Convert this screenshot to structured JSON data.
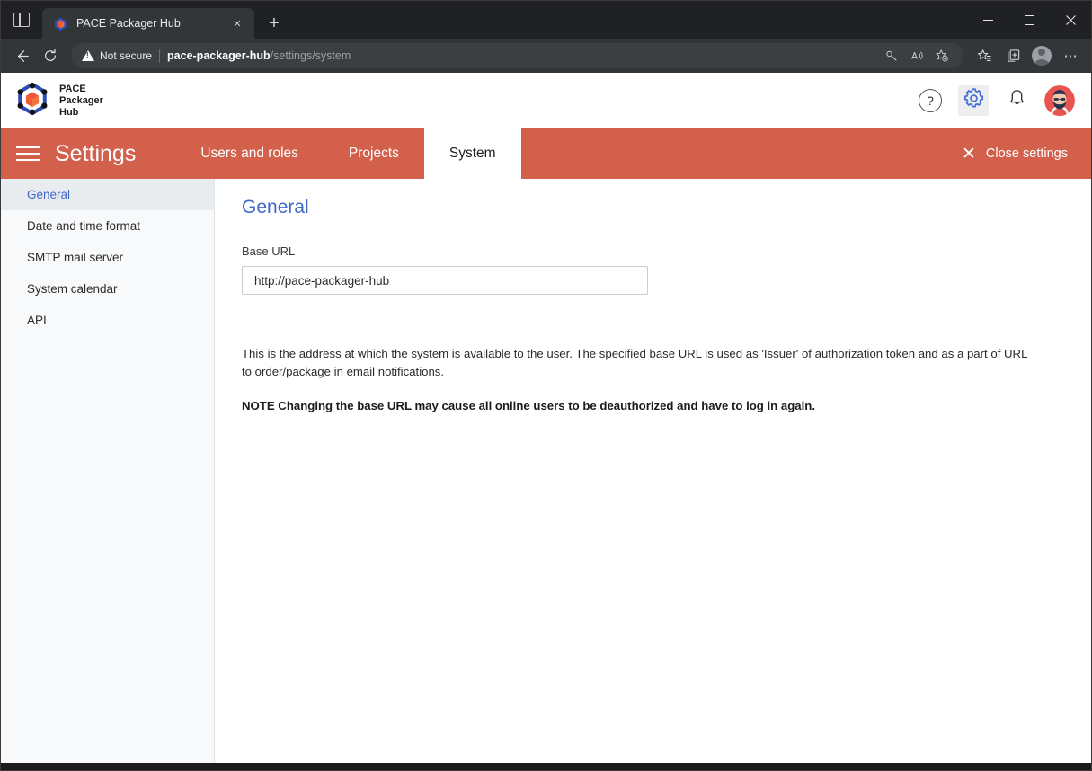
{
  "browser": {
    "tab": {
      "title": "PACE Packager Hub",
      "close_label": "×",
      "favicon_name": "pace-packager-hub-favicon"
    },
    "new_tab_label": "+",
    "window_controls": {
      "minimize": "—",
      "maximize": "☐",
      "close": "✕"
    },
    "toolbar": {
      "back_label": "←",
      "reload_label": "↻",
      "security_label": "Not secure",
      "url_host": "pace-packager-hub",
      "url_path": "/settings/system",
      "omnibox_icons": [
        "key-icon",
        "read-aloud-icon",
        "add-favorite-icon"
      ],
      "right_icons": [
        "favorites-icon",
        "collections-icon",
        "profile-icon",
        "settings-more-icon"
      ],
      "more_label": "⋯"
    }
  },
  "app": {
    "brand": {
      "line1": "PACE",
      "line2": "Packager",
      "line3": "Hub",
      "logo_name": "pace-packager-hub-logo"
    },
    "header_icons": {
      "help": "?",
      "gear": "gear-icon",
      "bell": "bell-icon",
      "avatar": "user-avatar"
    }
  },
  "settings_bar": {
    "menu_label": "menu",
    "title": "Settings",
    "tabs": [
      {
        "label": "Users and roles",
        "active": false
      },
      {
        "label": "Projects",
        "active": false
      },
      {
        "label": "System",
        "active": true
      }
    ],
    "close_label": "Close settings",
    "close_icon": "✕",
    "accent_color": "#d2604b"
  },
  "sidebar": {
    "items": [
      {
        "label": "General",
        "active": true
      },
      {
        "label": "Date and time format",
        "active": false
      },
      {
        "label": "SMTP mail server",
        "active": false
      },
      {
        "label": "System calendar",
        "active": false
      },
      {
        "label": "API",
        "active": false
      }
    ]
  },
  "main": {
    "title": "General",
    "base_url": {
      "label": "Base URL",
      "value": "http://pace-packager-hub",
      "placeholder": "http://pace-packager-hub"
    },
    "description": "This is the address at which the system is available to the user. The specified base URL is used as 'Issuer' of authorization token and as a part of URL to order/package in email notifications.",
    "note": "NOTE Changing the base URL may cause all online users to be deauthorized and have to log in again."
  },
  "colors": {
    "accent": "#d2604b",
    "link": "#4169c9",
    "sidebar_bg": "#f7f9fb"
  }
}
